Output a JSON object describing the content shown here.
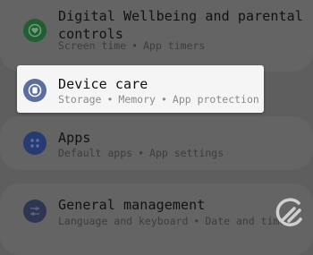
{
  "settings": {
    "items": [
      {
        "title_line1": "Digital Wellbeing and parental",
        "title_line2": "controls",
        "sub_parts": [
          "Screen time",
          "App timers"
        ],
        "icon": "wellbeing-heart-icon",
        "icon_color": "#1f5f31"
      },
      {
        "title": "Device care",
        "sub_parts": [
          "Storage",
          "Memory",
          "App protection"
        ],
        "icon": "device-care-icon",
        "icon_color": "#5b6f9e"
      },
      {
        "title": "Apps",
        "sub_parts": [
          "Default apps",
          "App settings"
        ],
        "icon": "apps-grid-icon",
        "icon_color": "#283a72"
      },
      {
        "title": "General management",
        "sub_parts": [
          "Language and keyboard",
          "Date and time"
        ],
        "icon": "sliders-icon",
        "icon_color": "#2e3654"
      }
    ],
    "separator": "•"
  },
  "watermark": {
    "icon": "watermark-logo-icon"
  }
}
